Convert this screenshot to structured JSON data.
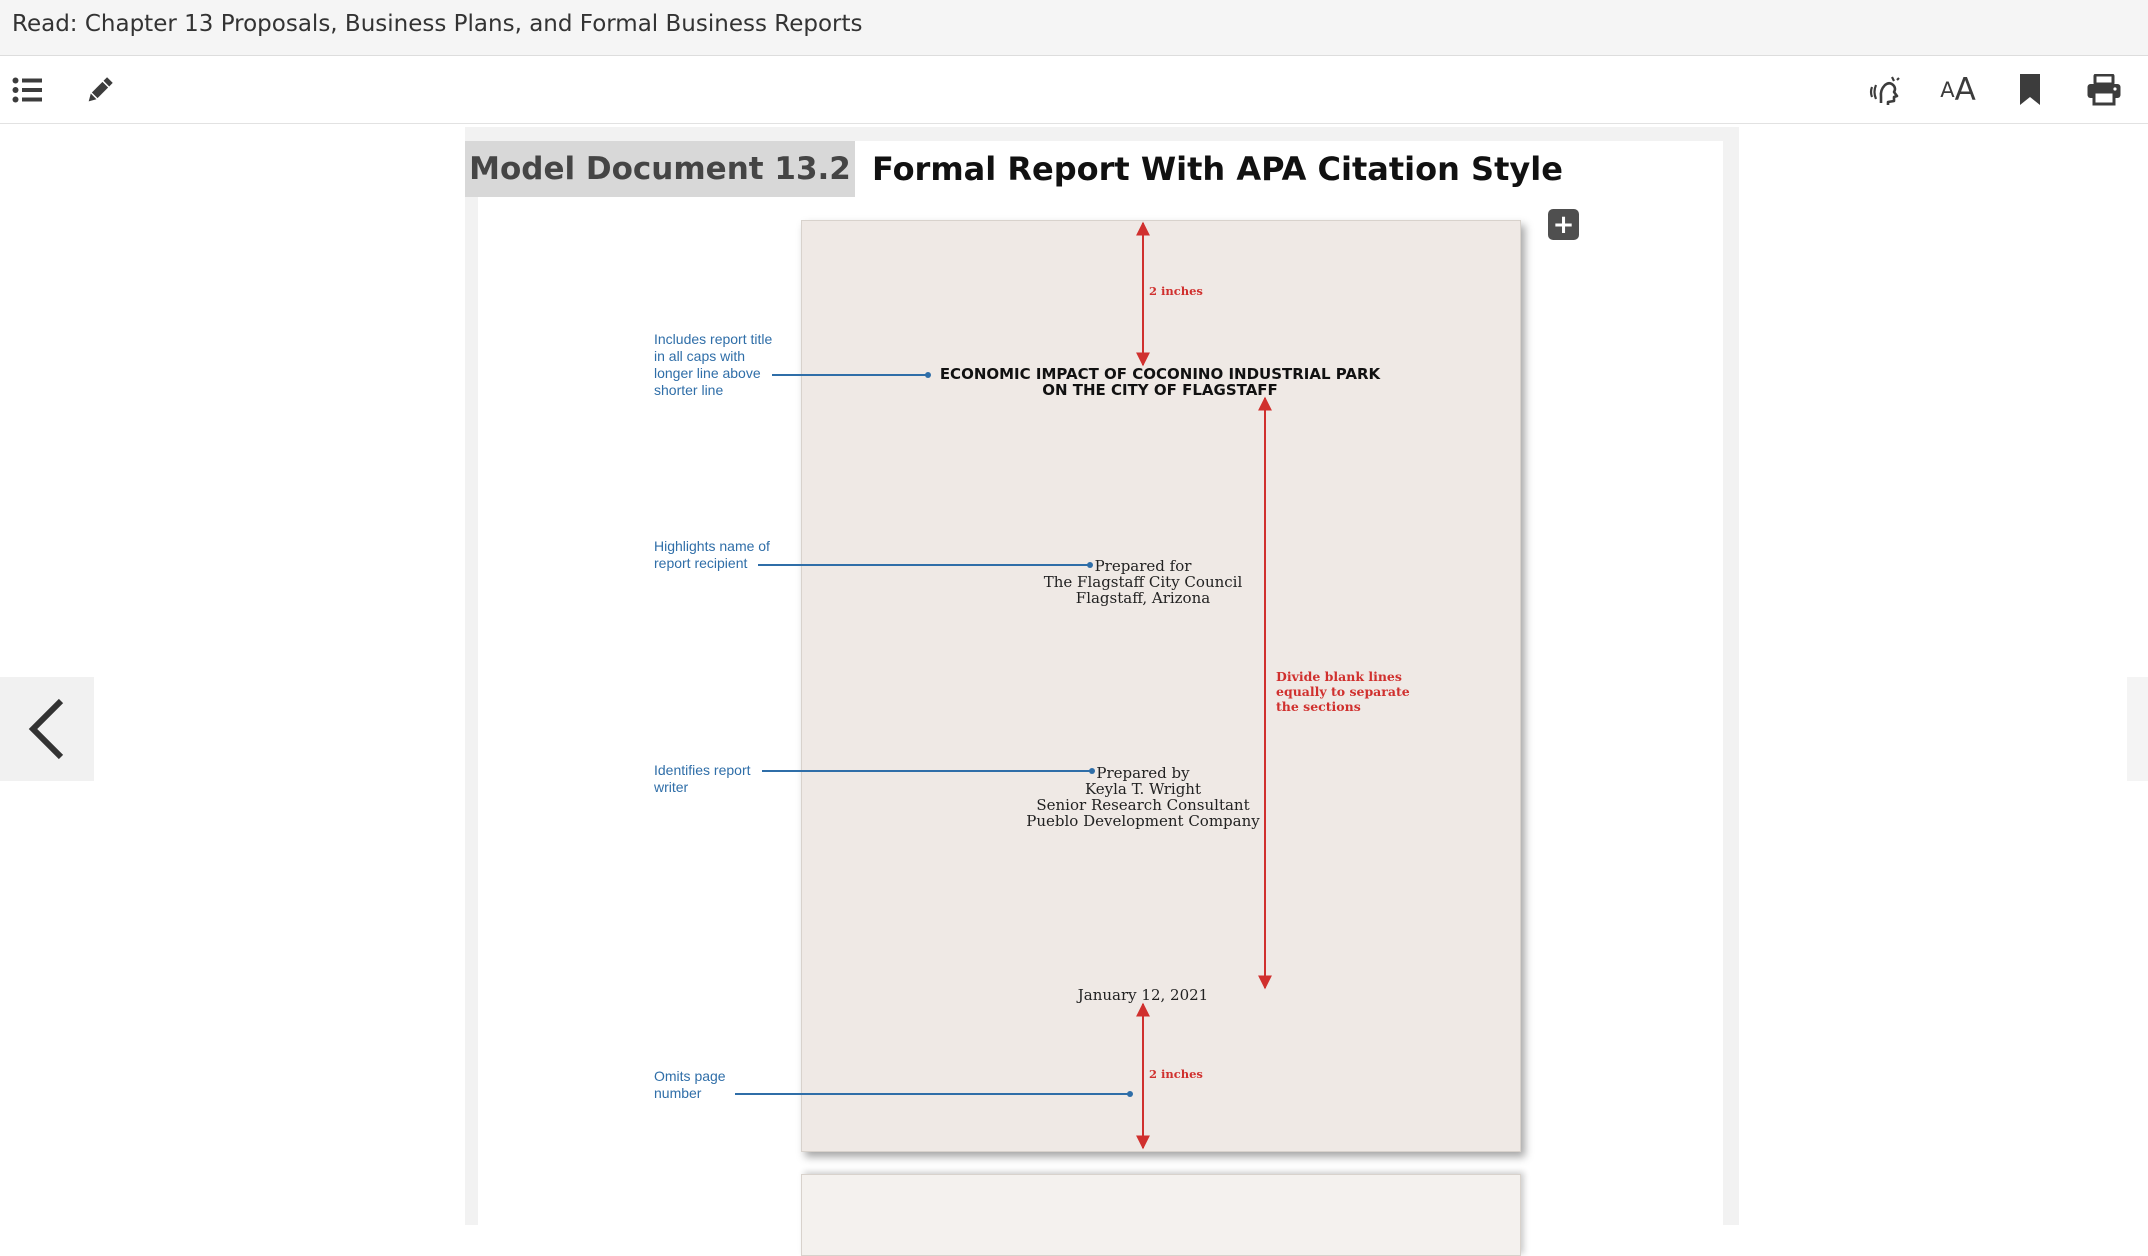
{
  "window": {
    "title": "Read: Chapter 13 Proposals, Business Plans, and Formal Business Reports"
  },
  "toolbar": {
    "left_icons": [
      "list-icon",
      "pencil-icon"
    ],
    "right_icons": [
      "read-aloud-icon",
      "text-size-icon",
      "bookmark-icon",
      "print-icon"
    ],
    "text_size_small": "A",
    "text_size_large": "A"
  },
  "navigation": {
    "prev_icon": "chevron-left-icon"
  },
  "figure": {
    "model_label": "Model Document 13.2",
    "title": "Formal Report With APA Citation Style",
    "zoom_icon": "plus-icon",
    "page": {
      "top_margin_label": "2 inches",
      "report_title_lines": [
        "ECONOMIC IMPACT OF COCONINO INDUSTRIAL PARK",
        "ON THE CITY OF FLAGSTAFF"
      ],
      "prepared_for_lines": [
        "Prepared for",
        "The Flagstaff City Council",
        "Flagstaff, Arizona"
      ],
      "divide_note_lines": [
        "Divide blank lines",
        "equally to separate",
        "the sections"
      ],
      "prepared_by_lines": [
        "Prepared by",
        "Keyla T. Wright",
        "Senior Research Consultant",
        "Pueblo Development Company"
      ],
      "date": "January 12, 2021",
      "bottom_margin_label": "2 inches"
    },
    "annotations": [
      {
        "lines": [
          "Includes report title",
          "in all caps with",
          "longer line above",
          "shorter line"
        ]
      },
      {
        "lines": [
          "Highlights name of",
          "report recipient"
        ]
      },
      {
        "lines": [
          "Identifies report",
          "writer"
        ]
      },
      {
        "lines": [
          "Omits page",
          "number"
        ]
      }
    ],
    "colors": {
      "annotation_blue": "#2f6ea8",
      "dimension_red": "#d0302e",
      "page_background": "#efe9e5"
    }
  }
}
